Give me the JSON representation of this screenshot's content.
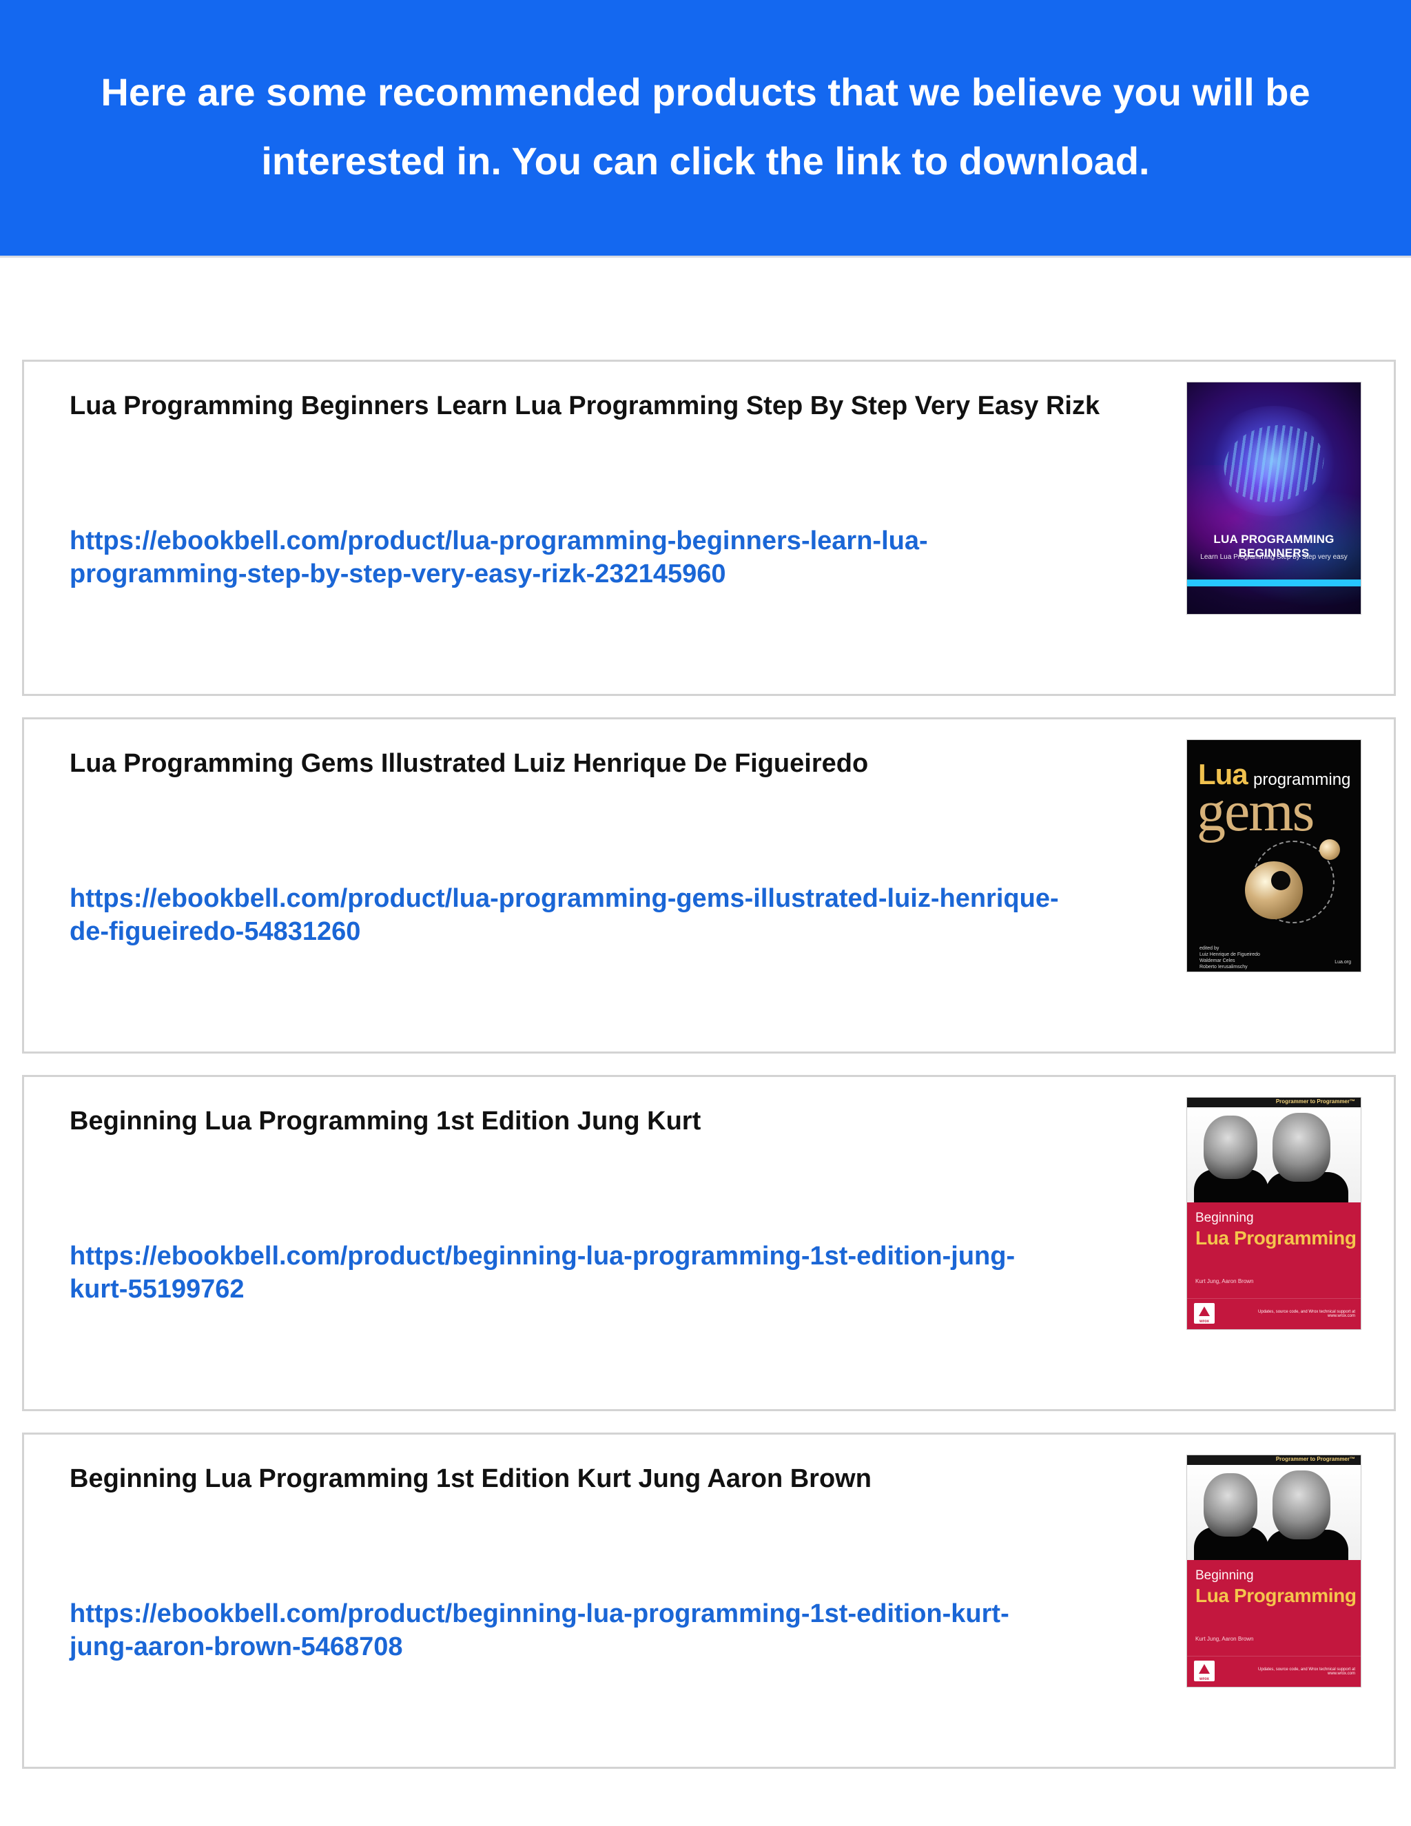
{
  "header": {
    "line_1": "Here are some recommended products that we believe you will be",
    "line_2": "interested in. You can click the link to download."
  },
  "products": [
    {
      "title": "Lua Programming Beginners Learn Lua Programming Step By Step Very Easy Rizk",
      "url": "https://ebookbell.com/product/lua-programming-beginners-learn-lua-programming-step-by-step-very-easy-rizk-232145960",
      "cover": {
        "title": "LUA PROGRAMMING BEGINNERS",
        "subtitle": "Learn Lua Programming Step by Step very easy"
      }
    },
    {
      "title": "Lua Programming Gems Illustrated Luiz Henrique De Figueiredo",
      "url": "https://ebookbell.com/product/lua-programming-gems-illustrated-luiz-henrique-de-figueiredo-54831260",
      "cover": {
        "lua": "Lua",
        "programming": "programming",
        "gems": "gems",
        "credits": "edited by\nLuiz Henrique de Figueiredo\nWaldemar Celes\nRoberto Ierusalimschy",
        "publisher": "Lua.org"
      }
    },
    {
      "title": "Beginning Lua Programming 1st Edition Jung Kurt",
      "url": "https://ebookbell.com/product/beginning-lua-programming-1st-edition-jung-kurt-55199762",
      "cover": {
        "series": "Programmer to Programmer™",
        "beginning": "Beginning",
        "lua_programming": "Lua Programming",
        "authors": "Kurt Jung, Aaron Brown",
        "publisher": "wrox",
        "footer": "Updates, source code, and Wrox technical support at www.wrox.com"
      }
    },
    {
      "title": "Beginning Lua Programming 1st Edition Kurt Jung Aaron Brown",
      "url": "https://ebookbell.com/product/beginning-lua-programming-1st-edition-kurt-jung-aaron-brown-5468708",
      "cover": {
        "series": "Programmer to Programmer™",
        "beginning": "Beginning",
        "lua_programming": "Lua Programming",
        "authors": "Kurt Jung, Aaron Brown",
        "publisher": "wrox",
        "footer": "Updates, source code, and Wrox technical support at www.wrox.com"
      }
    }
  ],
  "colors": {
    "banner": "#1468f0",
    "link": "#1a66d6",
    "title": "#111111",
    "border": "#d3d3d3"
  },
  "icons": {
    "wrox_logo": "wrox-logo-icon"
  }
}
